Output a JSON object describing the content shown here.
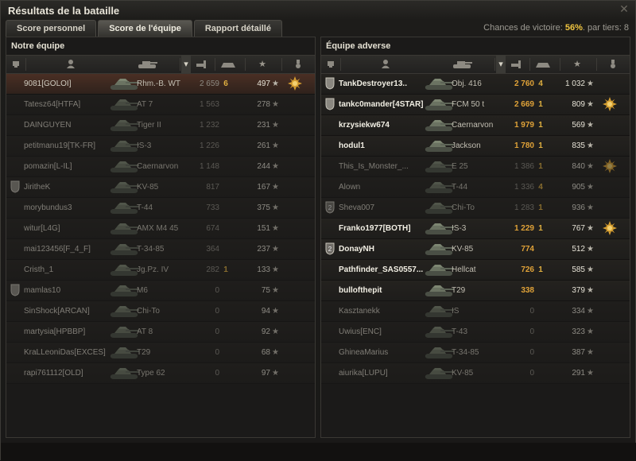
{
  "window": {
    "title": "Résultats de la bataille",
    "close_icon": "close-icon"
  },
  "tabs": [
    {
      "label": "Score personnel",
      "active": false
    },
    {
      "label": "Score de l'équipe",
      "active": true
    },
    {
      "label": "Rapport détaillé",
      "active": false
    }
  ],
  "victory": {
    "label": "Chances de victoire:",
    "value": "56%",
    "suffix": ". par tiers: 8"
  },
  "left": {
    "title": "Notre équipe",
    "rows": [
      {
        "name": "9081[GOLOI]",
        "tank": "Rhm.-B. WT",
        "xp": "2 659",
        "kills": "6",
        "score": "497",
        "badge": "",
        "medal": "medal-icon",
        "mine": true,
        "dead": false
      },
      {
        "name": "Tatesz64[HTFA]",
        "tank": "AT 7",
        "xp": "1 563",
        "kills": "",
        "score": "278",
        "badge": "",
        "medal": "",
        "mine": false,
        "dead": true
      },
      {
        "name": "DAINGUYEN",
        "tank": "Tiger II",
        "xp": "1 232",
        "kills": "",
        "score": "231",
        "badge": "",
        "medal": "",
        "mine": false,
        "dead": true
      },
      {
        "name": "petitmanu19[TK-FR]",
        "tank": "IS-3",
        "xp": "1 226",
        "kills": "",
        "score": "261",
        "badge": "",
        "medal": "",
        "mine": false,
        "dead": true
      },
      {
        "name": "pomazin[L-IL]",
        "tank": "Caernarvon",
        "xp": "1 148",
        "kills": "",
        "score": "244",
        "badge": "",
        "medal": "",
        "mine": false,
        "dead": true
      },
      {
        "name": "JiritheK",
        "tank": "KV-85",
        "xp": "817",
        "kills": "",
        "score": "167",
        "badge": "shield-icon",
        "medal": "",
        "mine": false,
        "dead": true
      },
      {
        "name": "morybundus3",
        "tank": "T-44",
        "xp": "733",
        "kills": "",
        "score": "375",
        "badge": "",
        "medal": "",
        "mine": false,
        "dead": true
      },
      {
        "name": "witur[L4G]",
        "tank": "AMX M4 45",
        "xp": "674",
        "kills": "",
        "score": "151",
        "badge": "",
        "medal": "",
        "mine": false,
        "dead": true
      },
      {
        "name": "mai123456[F_4_F]",
        "tank": "T-34-85",
        "xp": "364",
        "kills": "",
        "score": "237",
        "badge": "",
        "medal": "",
        "mine": false,
        "dead": true
      },
      {
        "name": "Cristh_1",
        "tank": "Jg.Pz. IV",
        "xp": "282",
        "kills": "1",
        "score": "133",
        "badge": "",
        "medal": "",
        "mine": false,
        "dead": true
      },
      {
        "name": "mamlas10",
        "tank": "M6",
        "xp": "0",
        "kills": "",
        "score": "75",
        "badge": "shield-icon",
        "medal": "",
        "mine": false,
        "dead": true
      },
      {
        "name": "SinShock[ARCAN]",
        "tank": "Chi-To",
        "xp": "0",
        "kills": "",
        "score": "94",
        "badge": "",
        "medal": "",
        "mine": false,
        "dead": true
      },
      {
        "name": "martysia[HPBBP]",
        "tank": "AT 8",
        "xp": "0",
        "kills": "",
        "score": "92",
        "badge": "",
        "medal": "",
        "mine": false,
        "dead": true
      },
      {
        "name": "KraLLeoniDas[EXCES]",
        "tank": "T29",
        "xp": "0",
        "kills": "",
        "score": "68",
        "badge": "",
        "medal": "",
        "mine": false,
        "dead": true
      },
      {
        "name": "rapi761112[OLD]",
        "tank": "Type 62",
        "xp": "0",
        "kills": "",
        "score": "97",
        "badge": "",
        "medal": "",
        "mine": false,
        "dead": true
      }
    ]
  },
  "right": {
    "title": "Équipe adverse",
    "rows": [
      {
        "name": "TankDestroyer13..",
        "tank": "Obj. 416",
        "xp": "2 760",
        "kills": "4",
        "score": "1 032",
        "badge": "shield-icon",
        "medal": "",
        "dead": false
      },
      {
        "name": "tankc0mander[4STAR]",
        "tank": "FCM 50 t",
        "xp": "2 669",
        "kills": "1",
        "score": "809",
        "badge": "shield-icon",
        "medal": "medal-icon",
        "dead": false
      },
      {
        "name": "krzysiekw674",
        "tank": "Caernarvon",
        "xp": "1 979",
        "kills": "1",
        "score": "569",
        "badge": "",
        "medal": "",
        "dead": false
      },
      {
        "name": "hodul1",
        "tank": "Jackson",
        "xp": "1 780",
        "kills": "1",
        "score": "835",
        "badge": "",
        "medal": "",
        "dead": false
      },
      {
        "name": "This_Is_Monster_...",
        "tank": "E 25",
        "xp": "1 386",
        "kills": "1",
        "score": "840",
        "badge": "",
        "medal": "medal-icon",
        "dead": true
      },
      {
        "name": "Alown",
        "tank": "T-44",
        "xp": "1 336",
        "kills": "4",
        "score": "905",
        "badge": "",
        "medal": "",
        "dead": true
      },
      {
        "name": "Sheva007",
        "tank": "Chi-To",
        "xp": "1 283",
        "kills": "1",
        "score": "936",
        "badge": "clan-2-icon",
        "medal": "",
        "dead": true
      },
      {
        "name": "Franko1977[BOTH]",
        "tank": "IS-3",
        "xp": "1 229",
        "kills": "1",
        "score": "767",
        "badge": "",
        "medal": "medal-icon",
        "dead": false
      },
      {
        "name": "DonayNH",
        "tank": "KV-85",
        "xp": "774",
        "kills": "",
        "score": "512",
        "badge": "clan-2-icon",
        "medal": "",
        "dead": false
      },
      {
        "name": "Pathfinder_SAS0557...",
        "tank": "Hellcat",
        "xp": "726",
        "kills": "1",
        "score": "585",
        "badge": "",
        "medal": "",
        "dead": false
      },
      {
        "name": "bullofthepit",
        "tank": "T29",
        "xp": "338",
        "kills": "",
        "score": "379",
        "badge": "",
        "medal": "",
        "dead": false
      },
      {
        "name": "Kasztanekk",
        "tank": "IS",
        "xp": "0",
        "kills": "",
        "score": "334",
        "badge": "",
        "medal": "",
        "dead": true
      },
      {
        "name": "Uwius[ENC]",
        "tank": "T-43",
        "xp": "0",
        "kills": "",
        "score": "323",
        "badge": "",
        "medal": "",
        "dead": true
      },
      {
        "name": "GhineaMarius",
        "tank": "T-34-85",
        "xp": "0",
        "kills": "",
        "score": "387",
        "badge": "",
        "medal": "",
        "dead": true
      },
      {
        "name": "aiurika[LUPU]",
        "tank": "KV-85",
        "xp": "0",
        "kills": "",
        "score": "291",
        "badge": "",
        "medal": "",
        "dead": true
      }
    ]
  },
  "columns": [
    "squad-icon",
    "player-icon",
    "tank-icon",
    "sort-arrow-icon",
    "damage-icon",
    "kills-icon",
    "star-icon",
    "medal-icon"
  ],
  "colors": {
    "accent": "#f0c540",
    "xp_enemy": "#e0a238",
    "mine_row": "#4a2f24"
  }
}
